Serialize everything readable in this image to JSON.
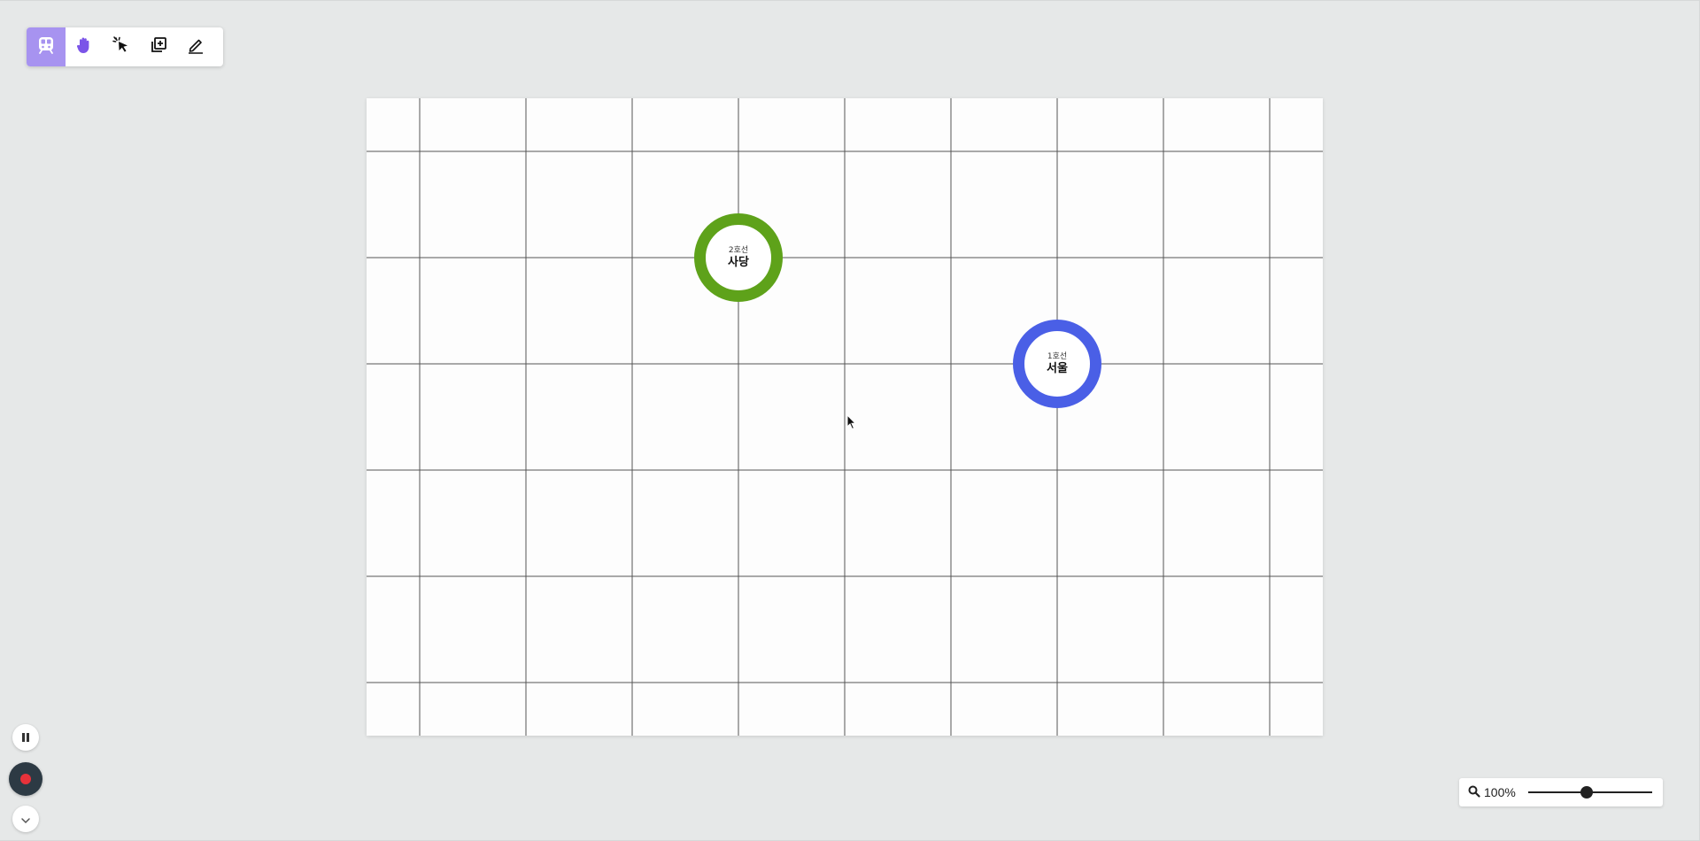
{
  "toolbar": {
    "tools": [
      {
        "icon": "subway-train-icon",
        "active": true
      },
      {
        "icon": "hand-pan-icon",
        "color": "#7b54e8"
      },
      {
        "icon": "select-cursor-icon"
      },
      {
        "icon": "add-layer-icon"
      },
      {
        "icon": "pencil-edit-icon"
      }
    ],
    "active_color": "#a793f0"
  },
  "canvas": {
    "stations": [
      {
        "line": "2호선",
        "name": "사당",
        "color": "#5ea21a",
        "grid_col": 3,
        "grid_row": 1.5
      },
      {
        "line": "1호선",
        "name": "서울",
        "color": "#4a5fe6",
        "grid_col": 6,
        "grid_row": 2.5
      }
    ]
  },
  "controls": {
    "pause_icon": "pause-icon",
    "record_icon": "record-icon",
    "record_color": "#e8323a",
    "expand_icon": "chevron-down-icon"
  },
  "zoom": {
    "icon": "magnifier-icon",
    "label": "100%",
    "slider_value": 0.47
  }
}
